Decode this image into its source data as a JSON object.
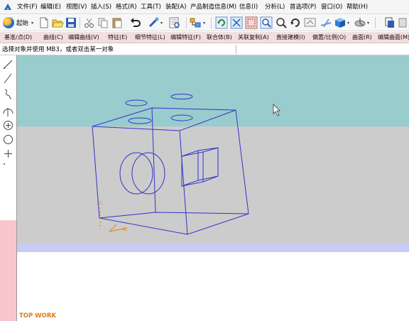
{
  "menubar": {
    "items": [
      "文件(F)",
      "编辑(E)",
      "视图(V)",
      "插入(S)",
      "格式(R)",
      "工具(T)",
      "装配(A)",
      "产品制造信息(M)",
      "信息(I)",
      "分析(L)",
      "首选项(P)",
      "窗口(O)",
      "帮助(H)"
    ]
  },
  "toolbar": {
    "start_label": "起始"
  },
  "command_bar": {
    "items": [
      "基准/点(D)",
      "曲线(C)",
      "编辑曲线(V)",
      "特征(E)",
      "细节特征(L)",
      "编辑特征(F)",
      "联合体(B)",
      "关联复制(A)",
      "直接建模(I)",
      "偏置/比例(O)",
      "曲面(R)",
      "编辑曲面(M)"
    ]
  },
  "status": {
    "prompt": "选择对象并使用 MB3，或者双击某一对象"
  },
  "viewport": {
    "view_name": "TOP WORK",
    "background_top_color": "#99cccc",
    "background_mid_color": "#cccccc",
    "wire_color": "#3333cc",
    "axis_color": "#e08020",
    "axis_labels": [
      "ZC",
      "XC"
    ]
  }
}
